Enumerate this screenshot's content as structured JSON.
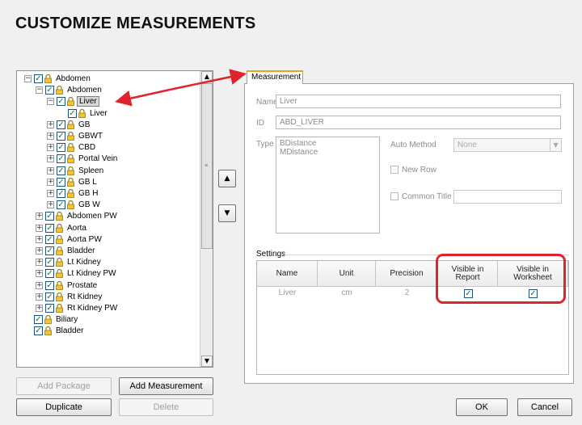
{
  "page_title": "CUSTOMIZE MEASUREMENTS",
  "tree": [
    {
      "label": "Abdomen",
      "level": 0,
      "expander": "−",
      "checked": true,
      "lock": true
    },
    {
      "label": "Abdomen",
      "level": 1,
      "expander": "−",
      "checked": true,
      "lock": true
    },
    {
      "label": "Liver",
      "level": 2,
      "expander": "−",
      "checked": true,
      "lock": true,
      "selected": true
    },
    {
      "label": "Liver",
      "level": 3,
      "expander": "",
      "checked": true,
      "lock": true
    },
    {
      "label": "GB",
      "level": 2,
      "expander": "+",
      "checked": true,
      "lock": true
    },
    {
      "label": "GBWT",
      "level": 2,
      "expander": "+",
      "checked": true,
      "lock": true
    },
    {
      "label": "CBD",
      "level": 2,
      "expander": "+",
      "checked": true,
      "lock": true
    },
    {
      "label": "Portal Vein",
      "level": 2,
      "expander": "+",
      "checked": true,
      "lock": true
    },
    {
      "label": "Spleen",
      "level": 2,
      "expander": "+",
      "checked": true,
      "lock": true
    },
    {
      "label": "GB L",
      "level": 2,
      "expander": "+",
      "checked": true,
      "lock": true
    },
    {
      "label": "GB H",
      "level": 2,
      "expander": "+",
      "checked": true,
      "lock": true
    },
    {
      "label": "GB W",
      "level": 2,
      "expander": "+",
      "checked": true,
      "lock": true
    },
    {
      "label": "Abdomen PW",
      "level": 1,
      "expander": "+",
      "checked": true,
      "lock": true
    },
    {
      "label": "Aorta",
      "level": 1,
      "expander": "+",
      "checked": true,
      "lock": true
    },
    {
      "label": "Aorta PW",
      "level": 1,
      "expander": "+",
      "checked": true,
      "lock": true
    },
    {
      "label": "Bladder",
      "level": 1,
      "expander": "+",
      "checked": true,
      "lock": true
    },
    {
      "label": "Lt Kidney",
      "level": 1,
      "expander": "+",
      "checked": true,
      "lock": true
    },
    {
      "label": "Lt Kidney PW",
      "level": 1,
      "expander": "+",
      "checked": true,
      "lock": true
    },
    {
      "label": "Prostate",
      "level": 1,
      "expander": "+",
      "checked": true,
      "lock": true
    },
    {
      "label": "Rt Kidney",
      "level": 1,
      "expander": "+",
      "checked": true,
      "lock": true
    },
    {
      "label": "Rt Kidney PW",
      "level": 1,
      "expander": "+",
      "checked": true,
      "lock": true
    },
    {
      "label": "Biliary",
      "level": 0,
      "expander": "",
      "checked": true,
      "lock": true
    },
    {
      "label": "Bladder",
      "level": 0,
      "expander": "",
      "checked": true,
      "lock": true
    }
  ],
  "buttons": {
    "add_package": "Add Package",
    "add_measurement": "Add Measurement",
    "duplicate": "Duplicate",
    "delete": "Delete",
    "ok": "OK",
    "cancel": "Cancel",
    "move_up": "▲",
    "move_down": "▼"
  },
  "tab": {
    "label": "Measurement"
  },
  "form": {
    "name_label": "Name",
    "name_value": "Liver",
    "id_label": "ID",
    "id_value": "ABD_LIVER",
    "type_label": "Type",
    "type_items": [
      "BDistance",
      "MDistance"
    ],
    "auto_method_label": "Auto Method",
    "auto_method_value": "None",
    "new_row_label": "New Row",
    "common_title_label": "Common Title"
  },
  "settings": {
    "label": "Settings",
    "columns": [
      "Name",
      "Unit",
      "Precision",
      "Visible in Report",
      "Visible in Worksheet"
    ],
    "column_lines": [
      [
        "Name"
      ],
      [
        "Unit"
      ],
      [
        "Precision"
      ],
      [
        "Visible in",
        "Report"
      ],
      [
        "Visible in",
        "Worksheet"
      ]
    ],
    "rows": [
      {
        "name": "Liver",
        "unit": "cm",
        "precision": "2",
        "visible_report": true,
        "visible_worksheet": true
      }
    ]
  },
  "colors": {
    "highlight": "#e0242c",
    "tab_accent": "#e8a317"
  }
}
